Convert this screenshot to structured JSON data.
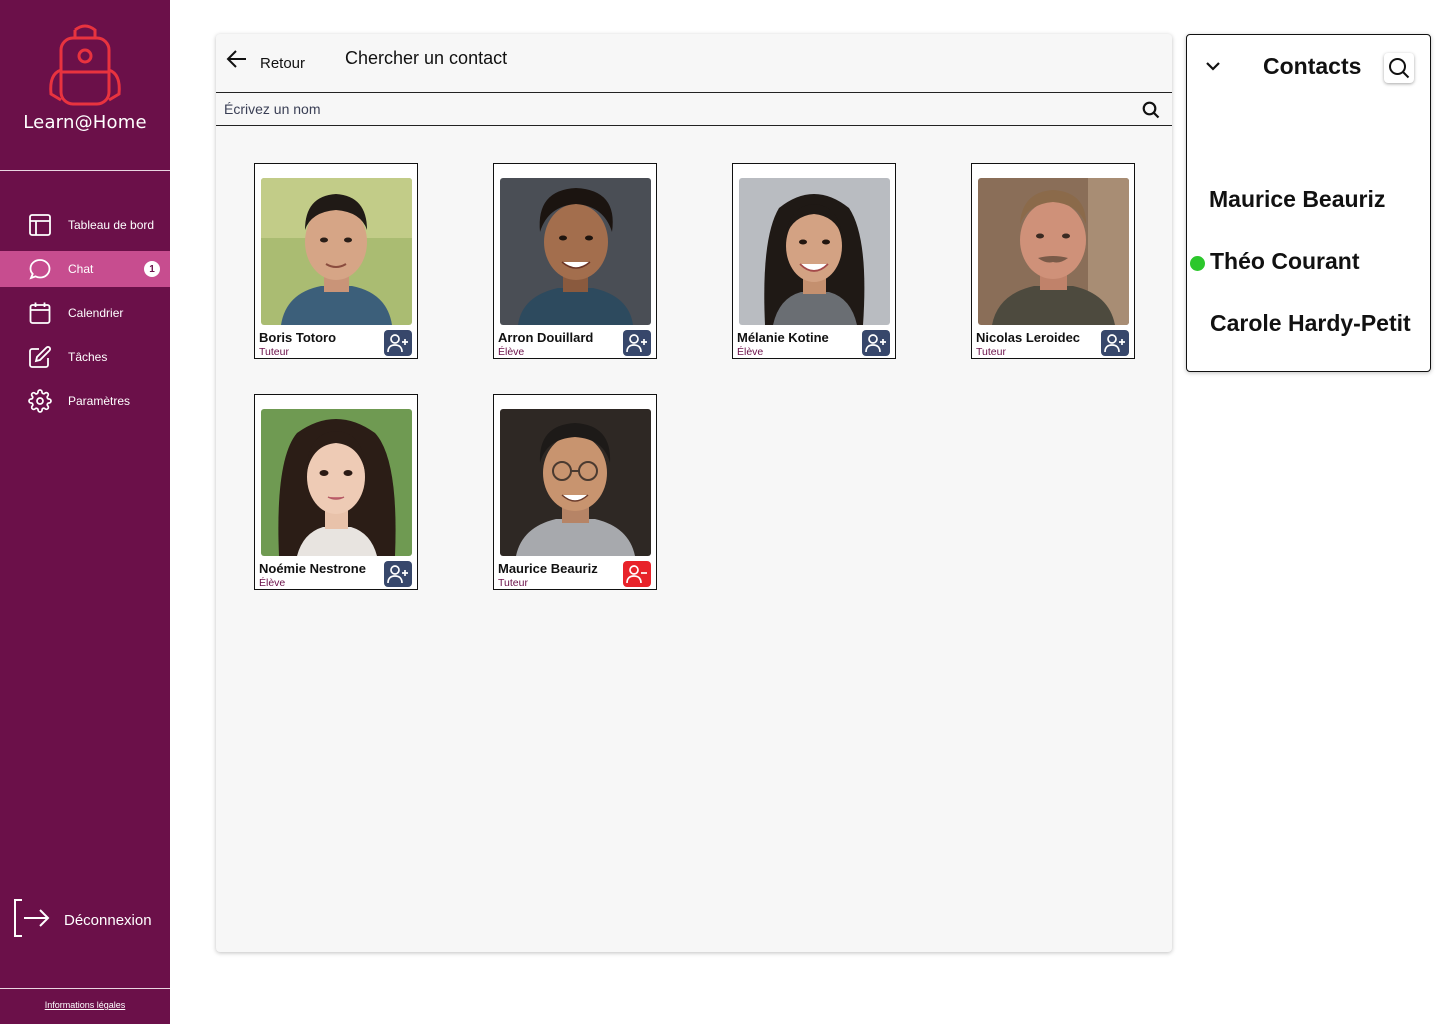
{
  "app": {
    "name": "Learn@Home",
    "accent": "#6b1049",
    "active_nav": "#c74d8f"
  },
  "sidebar": {
    "items": [
      {
        "label": "Tableau de bord",
        "icon": "dashboard-icon"
      },
      {
        "label": "Chat",
        "icon": "chat-icon",
        "badge": "1",
        "active": true
      },
      {
        "label": "Calendrier",
        "icon": "calendar-icon"
      },
      {
        "label": "Tâches",
        "icon": "edit-icon"
      },
      {
        "label": "Paramètres",
        "icon": "gear-icon"
      }
    ],
    "logout_label": "Déconnexion",
    "legal_label": "Informations légales"
  },
  "main": {
    "back_label": "Retour",
    "title": "Chercher un contact",
    "search_placeholder": "Écrivez un nom",
    "cards": [
      {
        "name": "Boris Totoro",
        "role": "Tuteur",
        "action": "add"
      },
      {
        "name": "Arron Douillard",
        "role": "Élève",
        "action": "add"
      },
      {
        "name": "Mélanie Kotine",
        "role": "Élève",
        "action": "add"
      },
      {
        "name": "Nicolas Leroidec",
        "role": "Tuteur",
        "action": "add"
      },
      {
        "name": "Noémie Nestrone",
        "role": "Élève",
        "action": "add"
      },
      {
        "name": "Maurice Beauriz",
        "role": "Tuteur",
        "action": "remove"
      }
    ]
  },
  "contacts": {
    "title": "Contacts",
    "items": [
      {
        "name": "Maurice Beauriz",
        "online": false
      },
      {
        "name": "Théo Courant",
        "online": true
      },
      {
        "name": "Carole Hardy-Petit",
        "online": false
      }
    ],
    "online_color": "#2cc72c"
  }
}
